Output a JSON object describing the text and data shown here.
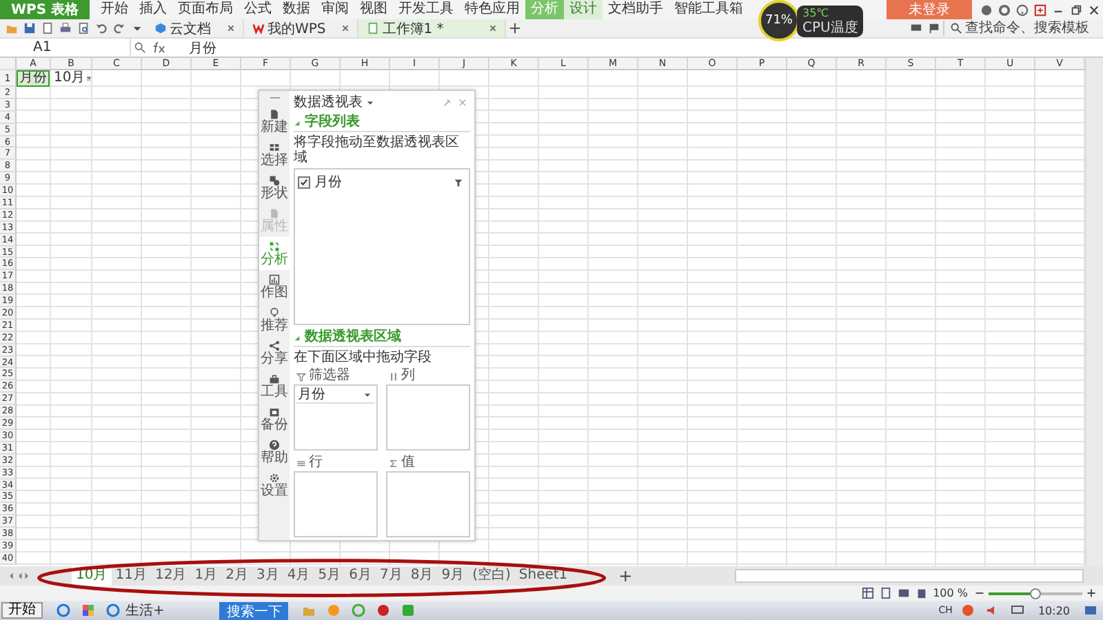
{
  "menu_bar": {
    "app_button": "WPS 表格",
    "tabs": [
      {
        "label": "开始",
        "selected": false,
        "context": false
      },
      {
        "label": "插入",
        "selected": false,
        "context": false
      },
      {
        "label": "页面布局",
        "selected": false,
        "context": false
      },
      {
        "label": "公式",
        "selected": false,
        "context": false
      },
      {
        "label": "数据",
        "selected": false,
        "context": false
      },
      {
        "label": "审阅",
        "selected": false,
        "context": false
      },
      {
        "label": "视图",
        "selected": false,
        "context": false
      },
      {
        "label": "开发工具",
        "selected": false,
        "context": false
      },
      {
        "label": "特色应用",
        "selected": false,
        "context": false
      },
      {
        "label": "分析",
        "selected": true,
        "context": true
      },
      {
        "label": "设计",
        "selected": false,
        "context": true
      },
      {
        "label": "文档助手",
        "selected": false,
        "context": false
      },
      {
        "label": "智能工具箱",
        "selected": false,
        "context": false
      }
    ],
    "login_button": "未登录"
  },
  "toolbar": {
    "doc_tabs": [
      {
        "label": "云文档",
        "selected": false,
        "kind": "cloud"
      },
      {
        "label": "我的WPS",
        "selected": false,
        "kind": "wps"
      },
      {
        "label": "工作簿1 *",
        "selected": true,
        "kind": "sheet"
      }
    ],
    "search": {
      "placeholder": "查找命令、搜索模板"
    }
  },
  "formula_bar": {
    "cell_ref": "A1",
    "value": "月份"
  },
  "cpu_widget": {
    "usage": "71%",
    "temperature": "35℃",
    "label": "CPU温度"
  },
  "sheet": {
    "columns": [
      "A",
      "B",
      "C",
      "D",
      "E",
      "F",
      "G",
      "H",
      "I",
      "J",
      "K",
      "L",
      "M",
      "N",
      "O",
      "P",
      "Q",
      "R",
      "S",
      "T",
      "U",
      "V"
    ],
    "row_numbers": [
      "1",
      "2",
      "3",
      "4",
      "5",
      "6",
      "7",
      "8",
      "9",
      "10",
      "11",
      "12",
      "13",
      "14",
      "15",
      "16",
      "17",
      "18",
      "19",
      "20",
      "21",
      "22",
      "23",
      "24",
      "25",
      "26",
      "27",
      "28",
      "29",
      "30",
      "31",
      "32",
      "33",
      "34",
      "35",
      "36",
      "37",
      "38",
      "39",
      "40"
    ],
    "row_1_cells": [
      {
        "text": "月份",
        "selected": true,
        "filter_button": false
      },
      {
        "text": "10月",
        "selected": false,
        "filter_button": true
      }
    ]
  },
  "pivot_panel": {
    "title": "数据透视表",
    "tools": [
      {
        "label": "新建",
        "kind": "new",
        "selected": false,
        "disabled": false
      },
      {
        "label": "选择",
        "kind": "select",
        "selected": false,
        "disabled": false
      },
      {
        "label": "形状",
        "kind": "shape",
        "selected": false,
        "disabled": false
      },
      {
        "label": "属性",
        "kind": "property",
        "selected": false,
        "disabled": true
      },
      {
        "label": "分析",
        "kind": "analyze",
        "selected": true,
        "disabled": false
      },
      {
        "label": "作图",
        "kind": "chart",
        "selected": false,
        "disabled": false
      },
      {
        "label": "推荐",
        "kind": "recommend",
        "selected": false,
        "disabled": false
      },
      {
        "label": "分享",
        "kind": "share",
        "selected": false,
        "disabled": false
      },
      {
        "label": "工具",
        "kind": "tools",
        "selected": false,
        "disabled": false
      },
      {
        "label": "备份",
        "kind": "backup",
        "selected": false,
        "disabled": false
      },
      {
        "label": "帮助",
        "kind": "help",
        "selected": false,
        "disabled": false
      },
      {
        "label": "设置",
        "kind": "settings",
        "selected": false,
        "disabled": false
      }
    ],
    "field_list": {
      "heading": "字段列表",
      "hint": "将字段拖动至数据透视表区域",
      "fields": [
        {
          "label": "月份",
          "checked": true
        }
      ]
    },
    "areas": {
      "heading": "数据透视表区域",
      "hint": "在下面区域中拖动字段",
      "zones": [
        {
          "label": "筛选器",
          "kind": "filter",
          "items": [
            "月份"
          ]
        },
        {
          "label": "列",
          "kind": "columns"
        },
        {
          "label": "行",
          "kind": "rows"
        },
        {
          "label": "值",
          "kind": "values"
        }
      ]
    }
  },
  "sheet_tabs": [
    {
      "label": "10月",
      "selected": true
    },
    {
      "label": "11月",
      "selected": false
    },
    {
      "label": "12月",
      "selected": false
    },
    {
      "label": "1月",
      "selected": false
    },
    {
      "label": "2月",
      "selected": false
    },
    {
      "label": "3月",
      "selected": false
    },
    {
      "label": "4月",
      "selected": false
    },
    {
      "label": "5月",
      "selected": false
    },
    {
      "label": "6月",
      "selected": false
    },
    {
      "label": "7月",
      "selected": false
    },
    {
      "label": "8月",
      "selected": false
    },
    {
      "label": "9月",
      "selected": false
    },
    {
      "label": "(空白)",
      "selected": false
    },
    {
      "label": "Sheet1",
      "selected": false
    }
  ],
  "add_sheet": "+",
  "status_bar": {
    "zoom": "100 %",
    "zoom_slider": {
      "level": 0.5
    }
  },
  "taskbar": {
    "start": "开始",
    "items": [
      {
        "label": "生活+"
      }
    ],
    "search_button": "搜索一下",
    "language": "CH",
    "time": "10:20"
  }
}
